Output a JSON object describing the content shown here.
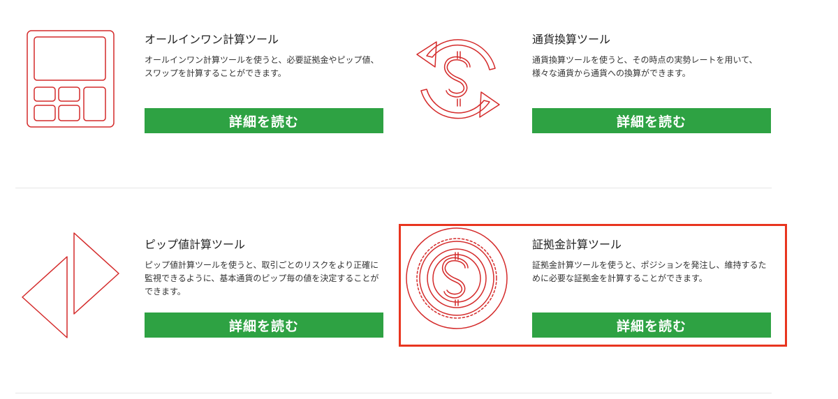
{
  "tools": [
    {
      "title": "オールインワン計算ツール",
      "description": "オールインワン計算ツールを使うと、必要証拠金やピップ値、スワップを計算することができます。",
      "button_label": "詳細を読む",
      "icon": "calculator-icon"
    },
    {
      "title": "通貨換算ツール",
      "description": "通貨換算ツールを使うと、その時点の実勢レートを用いて、様々な通貨から通貨への換算ができます。",
      "button_label": "詳細を読む",
      "icon": "currency-exchange-icon"
    },
    {
      "title": "ピップ値計算ツール",
      "description": "ピップ値計算ツールを使うと、取引ごとのリスクをより正確に監視できるように、基本通貨のピップ毎の値を決定することができます。",
      "button_label": "詳細を読む",
      "icon": "pip-arrows-icon"
    },
    {
      "title": "証拠金計算ツール",
      "description": "証拠金計算ツールを使うと、ポジションを発注し、維持するために必要な証拠金を計算することができます。",
      "button_label": "詳細を読む",
      "icon": "margin-coin-icon"
    }
  ],
  "colors": {
    "accent": "#2ea243",
    "icon_stroke": "#d42a2a",
    "highlight": "#e8351f",
    "divider": "#e6e6e6"
  }
}
